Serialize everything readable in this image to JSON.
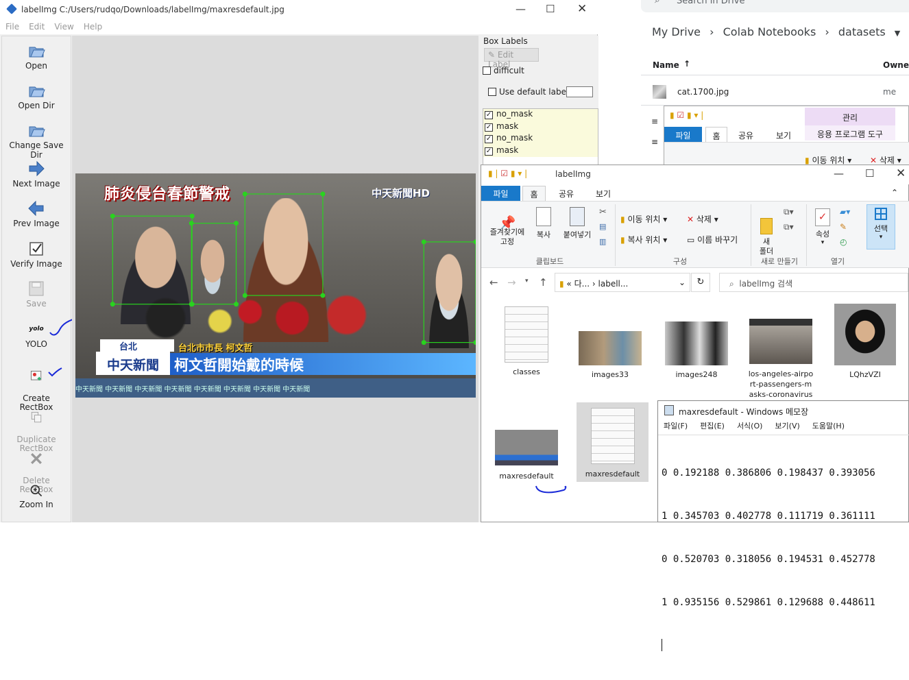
{
  "drive": {
    "search_placeholder": "Search in Drive",
    "breadcrumb": [
      "My Drive",
      "Colab Notebooks",
      "datasets"
    ],
    "columns": {
      "name": "Name",
      "owner": "Owner"
    },
    "file": {
      "name": "cat.1700.jpg",
      "owner": "me"
    }
  },
  "labelimg": {
    "title": "labelImg C:/Users/rudqo/Downloads/labelImg/maxresdefault.jpg",
    "menu": [
      "File",
      "Edit",
      "View",
      "Help"
    ],
    "tools": [
      {
        "label": "Open",
        "icon": "folder-open-icon"
      },
      {
        "label": "Open Dir",
        "icon": "folder-open-icon"
      },
      {
        "label": "Change Save Dir",
        "icon": "folder-open-icon"
      },
      {
        "label": "Next Image",
        "icon": "arrow-right-icon"
      },
      {
        "label": "Prev Image",
        "icon": "arrow-left-icon"
      },
      {
        "label": "Verify Image",
        "icon": "verify-icon"
      },
      {
        "label": "Save",
        "icon": "save-icon"
      },
      {
        "label": "YOLO",
        "icon": "yolo-icon",
        "icon_text": "yolo"
      },
      {
        "label": "Create\nRectBox",
        "icon": "create-rectbox-icon"
      },
      {
        "label": "Duplicate\nRectBox",
        "icon": "duplicate-rectbox-icon"
      },
      {
        "label": "Delete\nRectBox",
        "icon": "delete-rectbox-icon"
      },
      {
        "label": "Zoom In",
        "icon": "zoom-in-icon"
      }
    ],
    "dock": {
      "title": "Box Labels",
      "edit_label": "Edit Label",
      "difficult": "difficult",
      "use_default_label": "Use default label",
      "labels": [
        "no_mask",
        "mask",
        "no_mask",
        "mask"
      ]
    },
    "photo": {
      "headline": "肺炎侵台春節警戒",
      "channel": "中天新聞HD",
      "location": "台北",
      "caption_small": "台北市市長 柯文哲",
      "ticker_logo": "中天新聞",
      "ticker_text": "柯文哲開始戴的時候",
      "footer": "中天新聞 中天新聞 中天新聞 中天新聞 中天新聞 中天新聞 中天新聞 中天新聞"
    }
  },
  "explorer_back": {
    "tabs": [
      "파일",
      "홈",
      "공유",
      "보기"
    ],
    "manage": "관리",
    "app_tools": "응용 프로그램 도구",
    "move_to": "이동 위치",
    "delete": "삭제"
  },
  "explorer": {
    "title": "labelImg",
    "tabs": [
      "파일",
      "홈",
      "공유",
      "보기"
    ],
    "ribbon": {
      "pin": "즐겨찾기에\n고정",
      "copy": "복사",
      "paste": "붙여넣기",
      "clipboard_group": "클립보드",
      "move_to": "이동 위치",
      "copy_to": "복사 위치",
      "delete": "삭제",
      "rename": "이름 바꾸기",
      "organize_group": "구성",
      "new_folder": "새\n폴더",
      "new_group": "새로 만들기",
      "properties": "속성",
      "open_group": "열기",
      "select": "선택"
    },
    "address": [
      "다...",
      "labell..."
    ],
    "search_placeholder": "labelImg 검색",
    "files": [
      {
        "name": "classes",
        "kind": "text"
      },
      {
        "name": "images33",
        "kind": "image"
      },
      {
        "name": "images248",
        "kind": "image"
      },
      {
        "name": "los-angeles-airport-passengers-masks-coronavirus",
        "kind": "image"
      },
      {
        "name": "LQhzVZI",
        "kind": "image"
      },
      {
        "name": "maxresdefault",
        "kind": "image"
      },
      {
        "name": "maxresdefault",
        "kind": "text"
      }
    ]
  },
  "notepad": {
    "title": "maxresdefault - Windows 메모장",
    "menu": [
      "파일(F)",
      "편집(E)",
      "서식(O)",
      "보기(V)",
      "도움말(H)"
    ],
    "lines": [
      "0 0.192188 0.386806 0.198437 0.393056",
      "1 0.345703 0.402778 0.111719 0.361111",
      "0 0.520703 0.318056 0.194531 0.452778",
      "1 0.935156 0.529861 0.129688 0.448611"
    ]
  },
  "colors": {
    "box_green": "#29d31f",
    "accent_blue": "#1979ca",
    "label_bg": "#fafadc"
  }
}
